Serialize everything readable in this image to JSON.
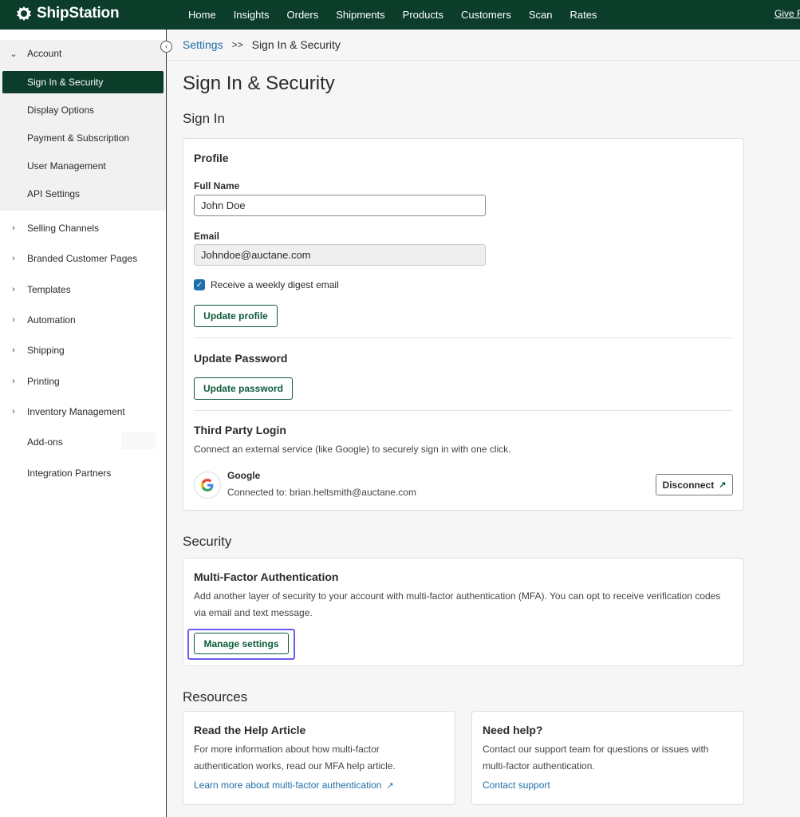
{
  "app": {
    "name": "ShipStation",
    "give_feedback": "Give Feedback"
  },
  "topnav": [
    "Home",
    "Insights",
    "Orders",
    "Shipments",
    "Products",
    "Customers",
    "Scan",
    "Rates"
  ],
  "sidebar": {
    "account": "Account",
    "account_items": [
      "Sign In & Security",
      "Display Options",
      "Payment & Subscription",
      "User Management",
      "API Settings"
    ],
    "groups": [
      "Selling Channels",
      "Branded Customer Pages",
      "Templates",
      "Automation",
      "Shipping",
      "Printing",
      "Inventory Management"
    ],
    "plain_items": [
      "Add-ons",
      "Integration Partners"
    ]
  },
  "breadcrumb": {
    "root": "Settings",
    "separator": ">>",
    "current": "Sign In & Security"
  },
  "page_title": "Sign In & Security",
  "sign_in": {
    "section_title": "Sign In",
    "profile_heading": "Profile",
    "full_name_label": "Full Name",
    "full_name_value": "John Doe",
    "email_label": "Email",
    "email_value": "Johndoe@auctane.com",
    "digest_label": "Receive a weekly digest email",
    "digest_checked": true,
    "update_profile": "Update profile",
    "password_heading": "Update Password",
    "update_password": "Update password",
    "third_party_heading": "Third Party Login",
    "third_party_desc": "Connect an external service (like Google) to securely sign in with one click.",
    "google_name": "Google",
    "google_connected": "Connected to: brian.heltsmith@auctane.com",
    "disconnect": "Disconnect"
  },
  "security": {
    "section_title": "Security",
    "mfa_heading": "Multi-Factor Authentication",
    "mfa_line1": "Add another layer of security to your account with multi-factor authentication (MFA). You can opt to receive verification codes",
    "mfa_line2": "via email and text message.",
    "manage_settings": "Manage settings"
  },
  "resources": {
    "section_title": "Resources",
    "help_heading": "Read the Help Article",
    "help_line1": "For more information about how multi-factor",
    "help_line2": "authentication works, read our MFA help article.",
    "help_link": "Learn more about multi-factor authentication",
    "support_heading": "Need help?",
    "support_line1": "Contact our support team for questions or issues with",
    "support_line2": "multi-factor authentication.",
    "support_link": "Contact support"
  },
  "colors": {
    "brand": "#0b3d2a",
    "link": "#1f6fa8",
    "button_text": "#0b5b3a",
    "highlight": "#6a5cf0"
  }
}
